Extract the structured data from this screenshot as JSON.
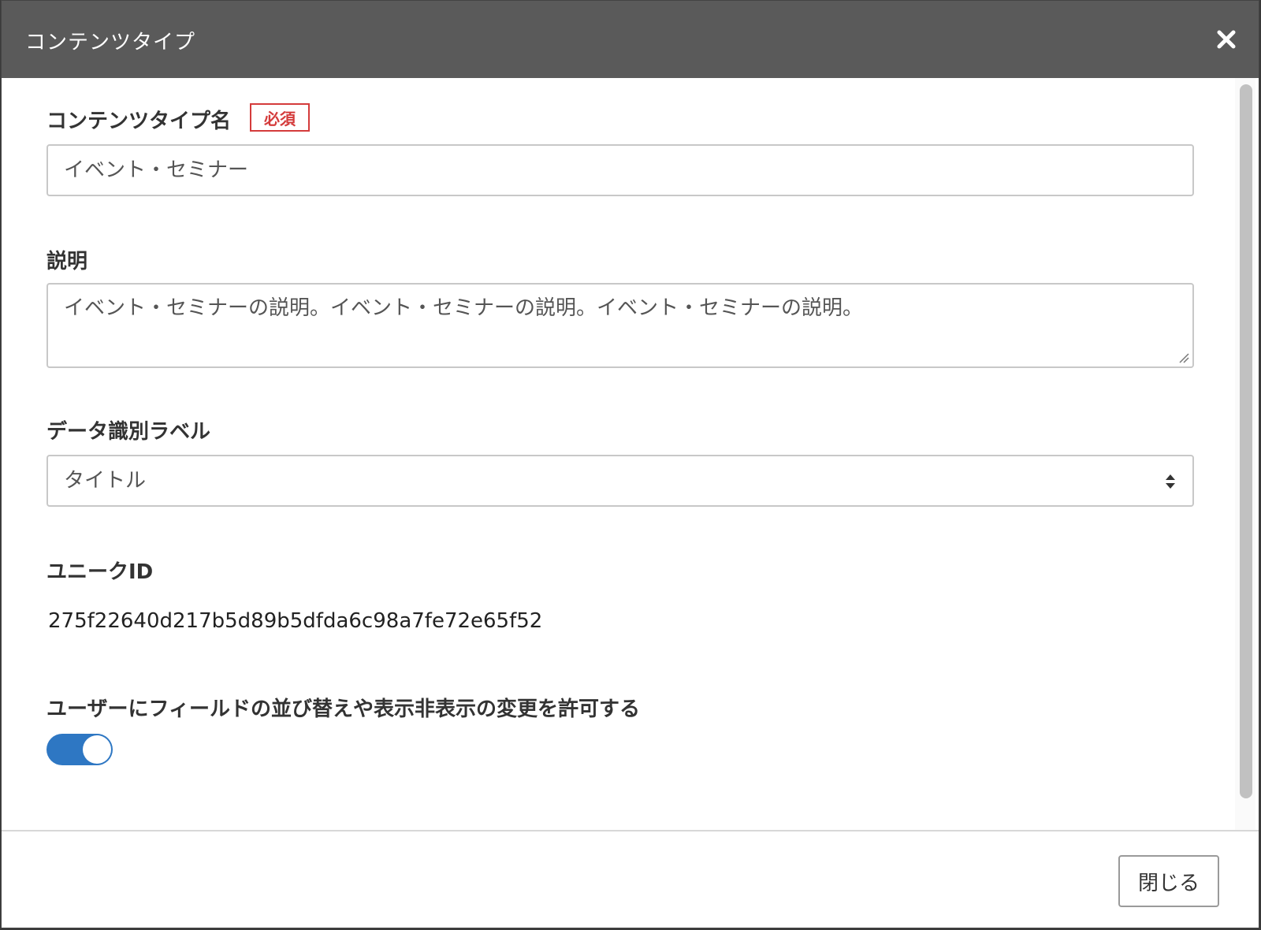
{
  "modal": {
    "title": "コンテンツタイプ",
    "close_icon": "close-icon"
  },
  "fields": {
    "name": {
      "label": "コンテンツタイプ名",
      "required_badge": "必須",
      "value": "イベント・セミナー"
    },
    "description": {
      "label": "説明",
      "value": "イベント・セミナーの説明。イベント・セミナーの説明。イベント・セミナーの説明。"
    },
    "data_label": {
      "label": "データ識別ラベル",
      "selected": "タイトル"
    },
    "unique_id": {
      "label": "ユニークID",
      "value": "275f22640d217b5d89b5dfda6c98a7fe72e65f52"
    },
    "allow_reorder": {
      "label": "ユーザーにフィールドの並び替えや表示非表示の変更を許可する",
      "enabled": true
    }
  },
  "footer": {
    "close_label": "閉じる"
  },
  "colors": {
    "header_bg": "#5a5a5a",
    "required": "#d43b3b",
    "toggle_on": "#2e77c3"
  }
}
